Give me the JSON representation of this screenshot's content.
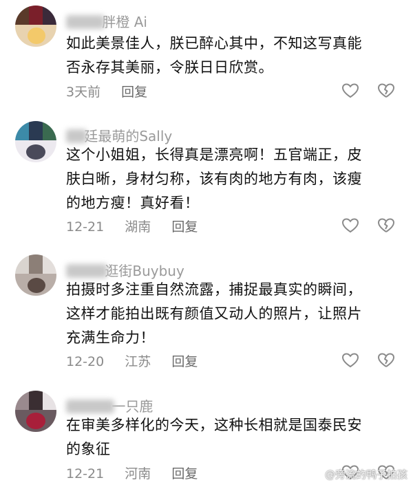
{
  "comments": [
    {
      "username": "胖橙 Ai",
      "text_lines": [
        "如此美景佳人，朕已醉心其中，不知这写真能",
        "否永存其美丽，令朕日日欣赏。"
      ],
      "time": "3天前",
      "location": "",
      "reply": "回复"
    },
    {
      "username": "廷最萌的Sally",
      "text_lines": [
        "这个小姐姐，长得真是漂亮啊！五官端正，皮",
        "肤白晰，身材匀称，该有肉的地方有肉，该瘦",
        "的地方瘦！真好看！"
      ],
      "time": "12-21",
      "location": "湖南",
      "reply": "回复"
    },
    {
      "username": "逛街Buybuy",
      "text_lines": [
        "拍摄时多注重自然流露，捕捉最真实的瞬间，",
        "这样才能拍出既有颜值又动人的照片，让照片",
        "充满生命力！"
      ],
      "time": "12-20",
      "location": "江苏",
      "reply": "回复"
    },
    {
      "username": "一只鹿",
      "text_lines": [
        "在审美多样化的今天，这种长相就是国泰民安",
        "的象征"
      ],
      "time": "12-21",
      "location": "河南",
      "reply": "回复"
    }
  ],
  "icons": {
    "like": "heart-outline-icon",
    "dislike": "broken-heart-outline-icon"
  },
  "colors": {
    "meta": "#8a8a8a",
    "username": "#9a9a9a",
    "text": "#111111"
  },
  "watermark": "@旁流的鸭子拍孩"
}
